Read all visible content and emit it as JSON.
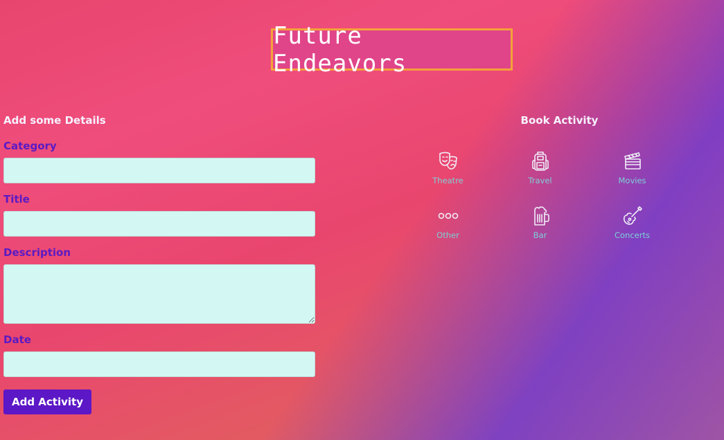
{
  "banner": {
    "title": "Future Endeavors"
  },
  "form": {
    "heading": "Add some Details",
    "fields": [
      {
        "label": "Category",
        "value": "",
        "placeholder": ""
      },
      {
        "label": "Title",
        "value": "",
        "placeholder": ""
      },
      {
        "label": "Description",
        "value": "",
        "placeholder": ""
      },
      {
        "label": "Date",
        "value": "",
        "placeholder": ""
      }
    ],
    "submit_label": "Add Activity"
  },
  "book": {
    "heading": "Book Activity",
    "activities": [
      {
        "label": "Theatre",
        "icon": "theatre-masks-icon"
      },
      {
        "label": "Travel",
        "icon": "backpack-icon"
      },
      {
        "label": "Movies",
        "icon": "clapperboard-icon"
      },
      {
        "label": "Other",
        "icon": "three-dots-icon"
      },
      {
        "label": "Bar",
        "icon": "beer-mug-icon"
      },
      {
        "label": "Concerts",
        "icon": "guitar-icon"
      }
    ]
  },
  "colors": {
    "banner_border": "#f4a23a",
    "label_purple": "#5a1bc4",
    "input_bg": "#d3f8f4",
    "button_bg": "#5c17c6",
    "activity_label": "#7ed0d8"
  }
}
